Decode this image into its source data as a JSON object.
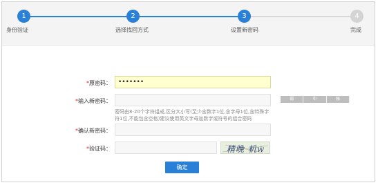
{
  "steps": [
    {
      "number": "1",
      "label": "身份验证",
      "state": "done"
    },
    {
      "number": "2",
      "label": "选择找回方式",
      "state": "done"
    },
    {
      "number": "3",
      "label": "设置新密码",
      "state": "current"
    },
    {
      "number": "4",
      "label": "完成",
      "state": "pending"
    }
  ],
  "colors": {
    "accent": "#2a7fd6",
    "required": "#d42020",
    "inactive_step": "#d4d4d4",
    "active_field": "#ffffcf"
  },
  "form": {
    "old_password": {
      "required_mark": "*",
      "label": "原密码：",
      "value": "•••••••"
    },
    "new_password": {
      "required_mark": "*",
      "label": "输入新密码：",
      "value": "",
      "strength_levels": [
        "弱",
        "中",
        "强"
      ],
      "hint": "密码由8-20个字符组成,区分大小写(至少含数字1位,含字母1位,含特殊字符1位,不能包含空格)建议使用英文字母加数字或符号的组合密码"
    },
    "confirm_password": {
      "required_mark": "*",
      "label": "确认新密码：",
      "value": ""
    },
    "captcha": {
      "required_mark": "*",
      "label": "验证码：",
      "value": "",
      "image_text": "精晚 机w"
    },
    "submit_label": "确定"
  }
}
